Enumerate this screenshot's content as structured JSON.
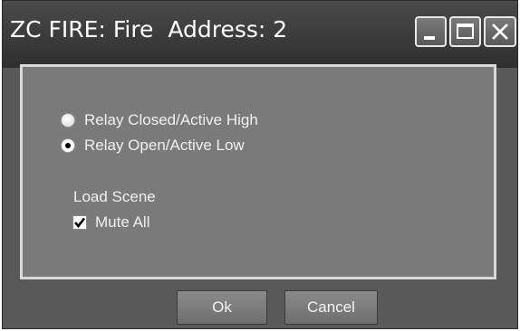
{
  "window": {
    "title": "ZC FIRE: Fire  Address: 2",
    "controls": [
      "minimize",
      "maximize",
      "close"
    ]
  },
  "options": {
    "relay_closed_label": "Relay Closed/Active High",
    "relay_open_label": "Relay Open/Active Low",
    "selected": "relay_open"
  },
  "load_scene": {
    "heading": "Load Scene",
    "mute_all_label": "Mute All",
    "mute_all_checked": true
  },
  "buttons": {
    "ok_label": "Ok",
    "cancel_label": "Cancel"
  },
  "colors": {
    "window_bg": "#595959",
    "panel_bg": "#7a7a7a",
    "panel_border": "#d9d9d9",
    "text": "#f0f0f0"
  }
}
